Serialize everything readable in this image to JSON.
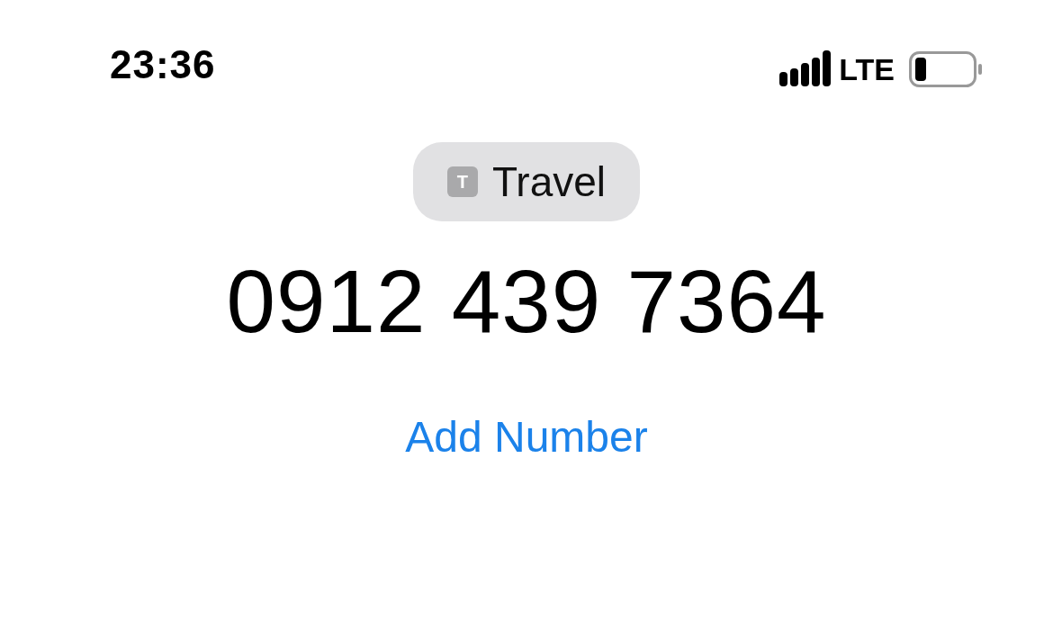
{
  "status_bar": {
    "time": "23:36",
    "network": "LTE"
  },
  "label_button": {
    "icon_letter": "T",
    "label": "Travel"
  },
  "phone_number": "0912 439 7364",
  "add_number_link": "Add Number"
}
